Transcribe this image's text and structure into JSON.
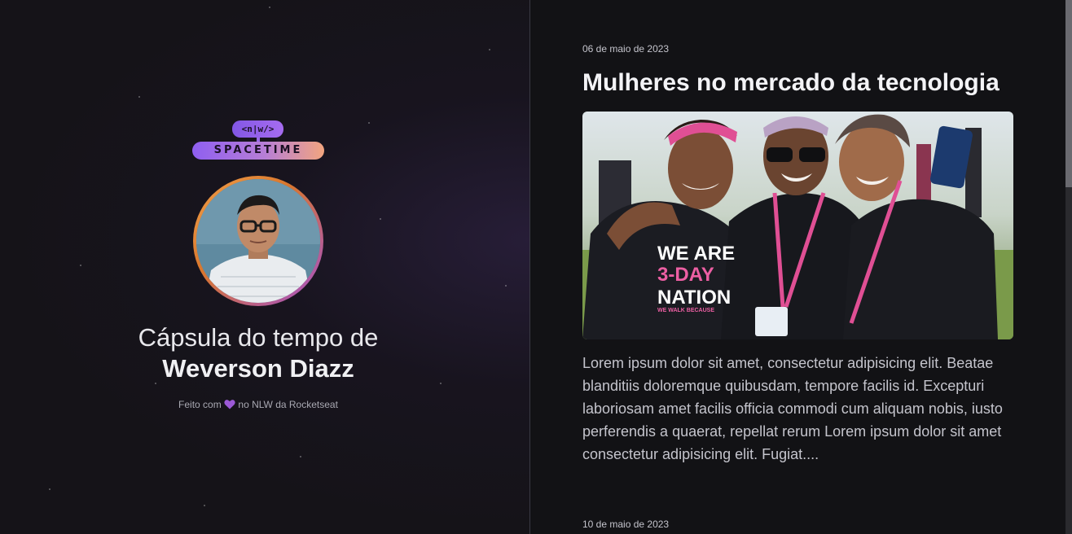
{
  "logo": {
    "tag": "<n|w/>",
    "name": "SPACETIME"
  },
  "profile": {
    "title_line1": "Cápsula do tempo de",
    "name": "Weverson Diazz",
    "made_with_prefix": "Feito com",
    "made_with_suffix": "no NLW da Rocketseat"
  },
  "posts": [
    {
      "date": "06 de maio de 2023",
      "title": "Mulheres no mercado da tecnologia",
      "image_shirt_text": [
        "WE ARE",
        "3-DAY",
        "NATION",
        "WE WALK BECAUSE"
      ],
      "body": "Lorem ipsum dolor sit amet, consectetur adipisicing elit. Beatae blanditiis doloremque quibusdam, tempore facilis id. Excepturi laboriosam amet facilis officia commodi cum aliquam nobis, iusto perferendis a quaerat, repellat rerum Lorem ipsum dolor sit amet consectetur adipisicing elit. Fugiat...."
    },
    {
      "date": "10 de maio de 2023"
    }
  ],
  "colors": {
    "accent_purple": "#8257e5",
    "accent_orange": "#f2a57f",
    "heart": "#9b59d6"
  }
}
